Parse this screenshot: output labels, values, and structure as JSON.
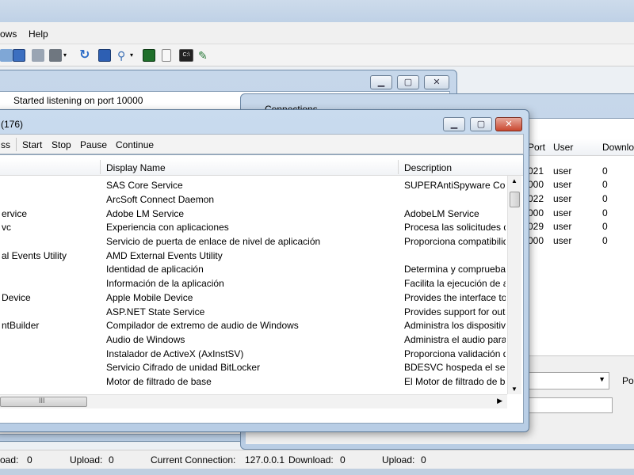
{
  "menu": {
    "windows_partial": "ows",
    "help": "Help"
  },
  "log_window": {
    "message": "Started listening on port 10000"
  },
  "connections_window": {
    "title": "Connections",
    "columns": [
      "Port",
      "User",
      "Downloa"
    ],
    "rows": [
      {
        "port": "021",
        "user": "user",
        "download": "0"
      },
      {
        "port": "000",
        "user": "user",
        "download": "0"
      },
      {
        "port": "022",
        "user": "user",
        "download": "0"
      },
      {
        "port": "000",
        "user": "user",
        "download": "0"
      },
      {
        "port": "029",
        "user": "user",
        "download": "0"
      },
      {
        "port": "000",
        "user": "user",
        "download": "0"
      }
    ],
    "right_label_partial": "Por"
  },
  "services_window": {
    "title": "(176)",
    "toolbar": {
      "first_partial": "ss",
      "start": "Start",
      "stop": "Stop",
      "pause": "Pause",
      "continue": "Continue"
    },
    "columns": {
      "display_name": "Display Name",
      "description": "Description"
    },
    "rows": [
      {
        "name": "",
        "display": "SAS Core Service",
        "desc": "SUPERAntiSpyware Core S"
      },
      {
        "name": "",
        "display": "ArcSoft Connect Daemon",
        "desc": ""
      },
      {
        "name": "ervice",
        "display": "Adobe LM Service",
        "desc": "AdobeLM Service"
      },
      {
        "name": "vc",
        "display": "Experiencia con aplicaciones",
        "desc": "Procesa las solicitudes de a"
      },
      {
        "name": "",
        "display": "Servicio de puerta de enlace de nivel de aplicación",
        "desc": "Proporciona compatibilidad"
      },
      {
        "name": "al Events Utility",
        "display": "AMD External Events Utility",
        "desc": ""
      },
      {
        "name": "",
        "display": "Identidad de aplicación",
        "desc": "Determina y comprueba la"
      },
      {
        "name": "",
        "display": "Información de la aplicación",
        "desc": "Facilita la ejecución de apli"
      },
      {
        "name": "Device",
        "display": "Apple Mobile Device",
        "desc": "Provides the interface to Ap"
      },
      {
        "name": "",
        "display": "ASP.NET State Service",
        "desc": "Provides support for out-of-"
      },
      {
        "name": "ntBuilder",
        "display": "Compilador de extremo de audio de Windows",
        "desc": "Administra los dispositivos d"
      },
      {
        "name": "",
        "display": "Audio de Windows",
        "desc": "Administra el audio para pro"
      },
      {
        "name": "",
        "display": "Instalador de ActiveX (AxInstSV)",
        "desc": "Proporciona validación de"
      },
      {
        "name": "",
        "display": "Servicio Cifrado de unidad BitLocker",
        "desc": "BDESVC hospeda el servici"
      },
      {
        "name": "",
        "display": "Motor de filtrado de base",
        "desc": "El Motor de filtrado de base"
      }
    ],
    "scroll_grip": "III"
  },
  "status": {
    "download_label_1": "oad:",
    "download_val_1": "0",
    "upload_label_1": "Upload:",
    "upload_val_1": "0",
    "current_label": "Current Connection:",
    "current_val": "127.0.0.1",
    "download_label_2": "Download:",
    "download_val_2": "0",
    "upload_label_2": "Upload:",
    "upload_val_2": "0"
  },
  "colors": {
    "accent": "#2f5f9e",
    "close_red": "#c9472f",
    "frame": "#b9cde4"
  },
  "toolbar_icons": [
    "connect-icon",
    "monitor-icon",
    "network-icon",
    "printer-icon",
    "dropdown-icon",
    "refresh-icon",
    "screen-icon",
    "search-icon",
    "dropdown-icon",
    "terminal-green-icon",
    "file-icon",
    "cmd-icon",
    "tools-icon"
  ]
}
